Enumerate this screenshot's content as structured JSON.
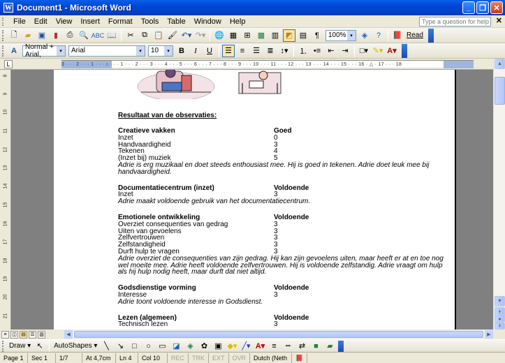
{
  "titlebar": {
    "title": "Document1 - Microsoft Word",
    "icon": "W"
  },
  "menu": {
    "items": [
      "File",
      "Edit",
      "View",
      "Insert",
      "Format",
      "Tools",
      "Table",
      "Window",
      "Help"
    ],
    "help_placeholder": "Type a question for help"
  },
  "standard_toolbar": {
    "zoom": "100%",
    "read_label": "Read"
  },
  "formatting_toolbar": {
    "style": "Normal + Arial,",
    "font": "Arial",
    "size": "10"
  },
  "ruler": {
    "numbers": "3 · · · 2 · · · 1 · · · ⌂ · · · 1 · · · 2 · · · 3 · · · 4 · · · 5 · · · 6 · · · 7 · · · 8 · · · 9 · · · 10 · · · 11 · · · 12 · · · 13 · · · 14 · · · 15 · · · 16 · △ · 17 · · · 18"
  },
  "vruler": [
    "8",
    "9",
    "10",
    "11",
    "12",
    "13",
    "14",
    "15",
    "16",
    "17",
    "18",
    "19",
    "20",
    "21"
  ],
  "document": {
    "heading": "Resultaat van de observaties:",
    "sections": [
      {
        "title": "Creatieve vakken",
        "grade": "Goed",
        "rows": [
          [
            "Inzet",
            "0"
          ],
          [
            "Handvaardigheid",
            "3"
          ],
          [
            "Tekenen",
            "4"
          ],
          [
            "(Inzet bij) muziek",
            "5"
          ]
        ],
        "comment": [
          "Adrie is erg muzikaal en doet steeds enthousiast mee. Hij is goed in tekenen. Adrie doet leuk mee bij",
          "handvaardigheid."
        ]
      },
      {
        "title": "Documentatiecentrum (inzet)",
        "grade": "Voldoende",
        "rows": [
          [
            "Inzet",
            "3"
          ]
        ],
        "comment": [
          "Adrie maakt voldoende gebruik van het documentatiecentrum."
        ]
      },
      {
        "title": "Emotionele ontwikkeling",
        "grade": "Voldoende",
        "rows": [
          [
            "Overziet consequenties van gedrag",
            "3"
          ],
          [
            "Uiten van gevoelens",
            "3"
          ],
          [
            "Zelfvertrouwen",
            "3"
          ],
          [
            "Zelfstandigheid",
            "3"
          ],
          [
            "Durft hulp te vragen",
            "3"
          ]
        ],
        "comment": [
          "Adrie overziet de consequenties van zijn gedrag. Hij kan zijn gevoelens uiten, maar heeft er at en toe nog",
          "wel moeite mee. Adrie heeft voldoende zelfvertrouwen. Hij is voldoende zelfstandig. Adrie vraagt om hulp",
          "als hij hulp nodig heeft, maar durft dat niet altijd."
        ]
      },
      {
        "title": "Godsdienstige vorming",
        "grade": "Voldoende",
        "rows": [
          [
            "Interesse",
            "3"
          ]
        ],
        "comment": [
          "Adrie toont voldoende interesse in Godsdienst."
        ]
      },
      {
        "title": "Lezen (algemeen)",
        "grade": "Voldoende",
        "rows": [
          [
            "Technisch lezen",
            "3"
          ]
        ],
        "comment": []
      }
    ]
  },
  "drawing_toolbar": {
    "draw_label": "Draw ▾",
    "autoshapes_label": "AutoShapes ▾"
  },
  "status": {
    "page": "Page 1",
    "sec": "Sec 1",
    "pages": "1/7",
    "at": "At 4,7cm",
    "ln": "Ln 4",
    "col": "Col 10",
    "rec": "REC",
    "trk": "TRK",
    "ext": "EXT",
    "ovr": "OVR",
    "lang": "Dutch (Neth"
  },
  "colors": {
    "title_blue": "#0046d5",
    "page_bg": "#ffffff",
    "desk_gray": "#808080"
  }
}
